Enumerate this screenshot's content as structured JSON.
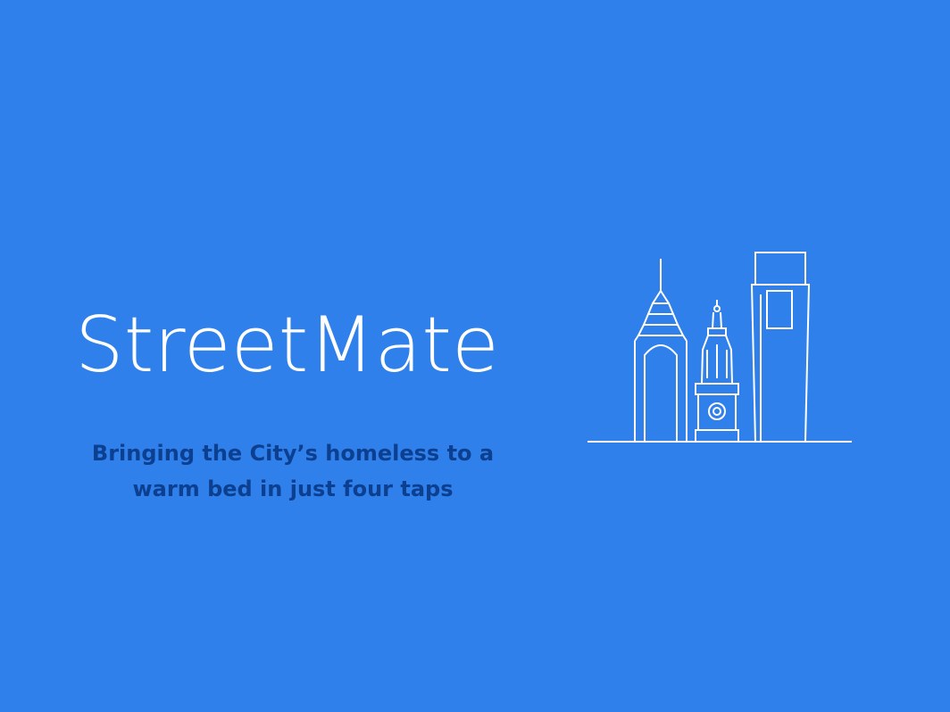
{
  "slide": {
    "title": "StreetMate",
    "tagline": "Bringing the City’s homeless to a warm bed in just four taps",
    "illustration": "city-skyline-icon",
    "colors": {
      "background": "#2f80ea",
      "title": "#ffffff",
      "tagline": "#0c3f8f",
      "illustration_stroke": "#ffffff"
    }
  }
}
